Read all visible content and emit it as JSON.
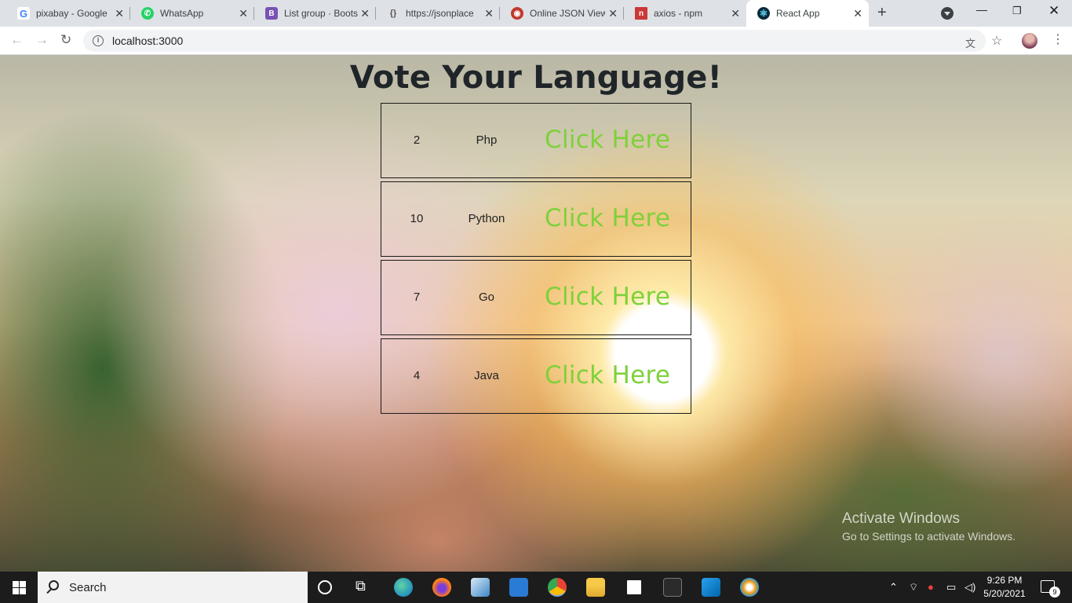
{
  "browser": {
    "tabs": [
      {
        "title": "pixabay - Google",
        "icon": "google-icon",
        "color": "#4285f4",
        "glyph": "G"
      },
      {
        "title": "WhatsApp",
        "icon": "whatsapp-icon",
        "color": "#25d366",
        "glyph": "✆"
      },
      {
        "title": "List group · Boots",
        "icon": "bootstrap-icon",
        "color": "#7952b3",
        "glyph": "B"
      },
      {
        "title": "https://jsonplace",
        "icon": "jsonplaceholder-icon",
        "color": "#555555",
        "glyph": "{}"
      },
      {
        "title": "Online JSON View",
        "icon": "json-viewer-icon",
        "color": "#c0392b",
        "glyph": "◉"
      },
      {
        "title": "axios - npm",
        "icon": "npm-icon",
        "color": "#cb3837",
        "glyph": "n"
      },
      {
        "title": "React App",
        "icon": "react-icon",
        "color": "#0a2a3a",
        "glyph": "⚛"
      }
    ],
    "url": "localhost:3000"
  },
  "page": {
    "heading": "Vote Your Language!",
    "languages": [
      {
        "count": "2",
        "name": "Php",
        "button": "Click Here"
      },
      {
        "count": "10",
        "name": "Python",
        "button": "Click Here"
      },
      {
        "count": "7",
        "name": "Go",
        "button": "Click Here"
      },
      {
        "count": "4",
        "name": "Java",
        "button": "Click Here"
      }
    ],
    "accent_color": "#7ed13a"
  },
  "watermark": {
    "line1": "Activate Windows",
    "line2": "Go to Settings to activate Windows."
  },
  "taskbar": {
    "search_label": "Search",
    "time": "9:26 PM",
    "date": "5/20/2021",
    "notification_count": "9"
  }
}
